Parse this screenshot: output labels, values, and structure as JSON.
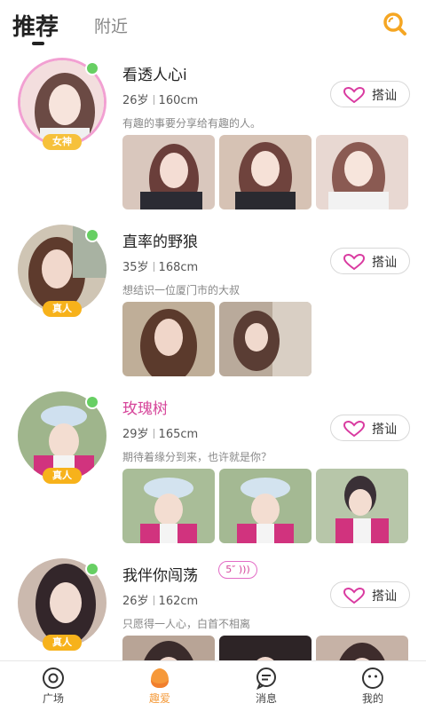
{
  "header": {
    "tabs": [
      {
        "label": "推荐"
      },
      {
        "label": "附近"
      }
    ],
    "search_icon": "search-icon",
    "accent": "#f5a623"
  },
  "users": [
    {
      "name": "看透人心i",
      "age": "26岁",
      "height": "160cm",
      "intro": "有趣的事要分享给有趣的人。",
      "badge": "女神",
      "online": true,
      "greet": "搭讪"
    },
    {
      "name": "直率的野狼",
      "age": "35岁",
      "height": "168cm",
      "intro": "想结识一位厦门市的大叔",
      "badge": "真人",
      "online": true,
      "greet": "搭讪"
    },
    {
      "name": "玫瑰树",
      "age": "29岁",
      "height": "165cm",
      "intro": "期待着缘分到来，也许就是你？",
      "badge": "真人",
      "online": true,
      "greet": "搭讪"
    },
    {
      "name": "我伴你闯荡",
      "voice": "5″",
      "age": "26岁",
      "height": "162cm",
      "intro": "只愿得一人心，白首不相离",
      "badge": "真人",
      "online": true,
      "greet": "搭讪"
    }
  ],
  "tabbar": [
    {
      "label": "广场",
      "icon": "compass-icon"
    },
    {
      "label": "趣爱",
      "icon": "heart-blob-icon"
    },
    {
      "label": "消息",
      "icon": "message-icon"
    },
    {
      "label": "我的",
      "icon": "face-icon"
    }
  ],
  "colors": {
    "accent": "#f5a623",
    "pink": "#d6459a",
    "online": "#67cf63",
    "badge": "#f7b21b"
  }
}
